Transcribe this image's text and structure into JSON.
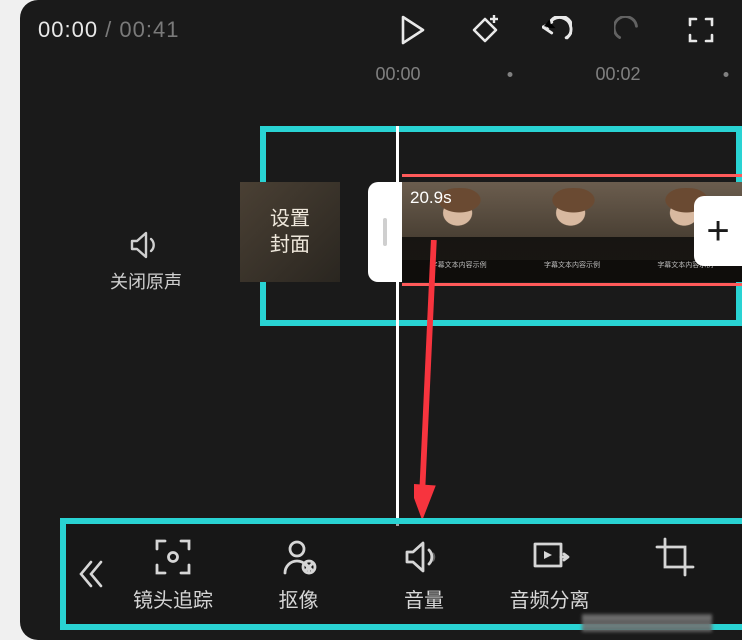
{
  "time": {
    "current": "00:00",
    "separator": " / ",
    "total": "00:41"
  },
  "ruler": {
    "t0": "00:00",
    "t1": "00:02"
  },
  "mute": {
    "label": "关闭原声"
  },
  "cover": {
    "line1": "设置",
    "line2": "封面"
  },
  "clip": {
    "duration": "20.9s"
  },
  "toolbar": {
    "items": [
      {
        "label": "镜头追踪"
      },
      {
        "label": "抠像"
      },
      {
        "label": "音量"
      },
      {
        "label": "音频分离"
      },
      {
        "label": ""
      }
    ]
  },
  "colors": {
    "highlight": "#29d3d3",
    "arrow": "#f7343e"
  }
}
